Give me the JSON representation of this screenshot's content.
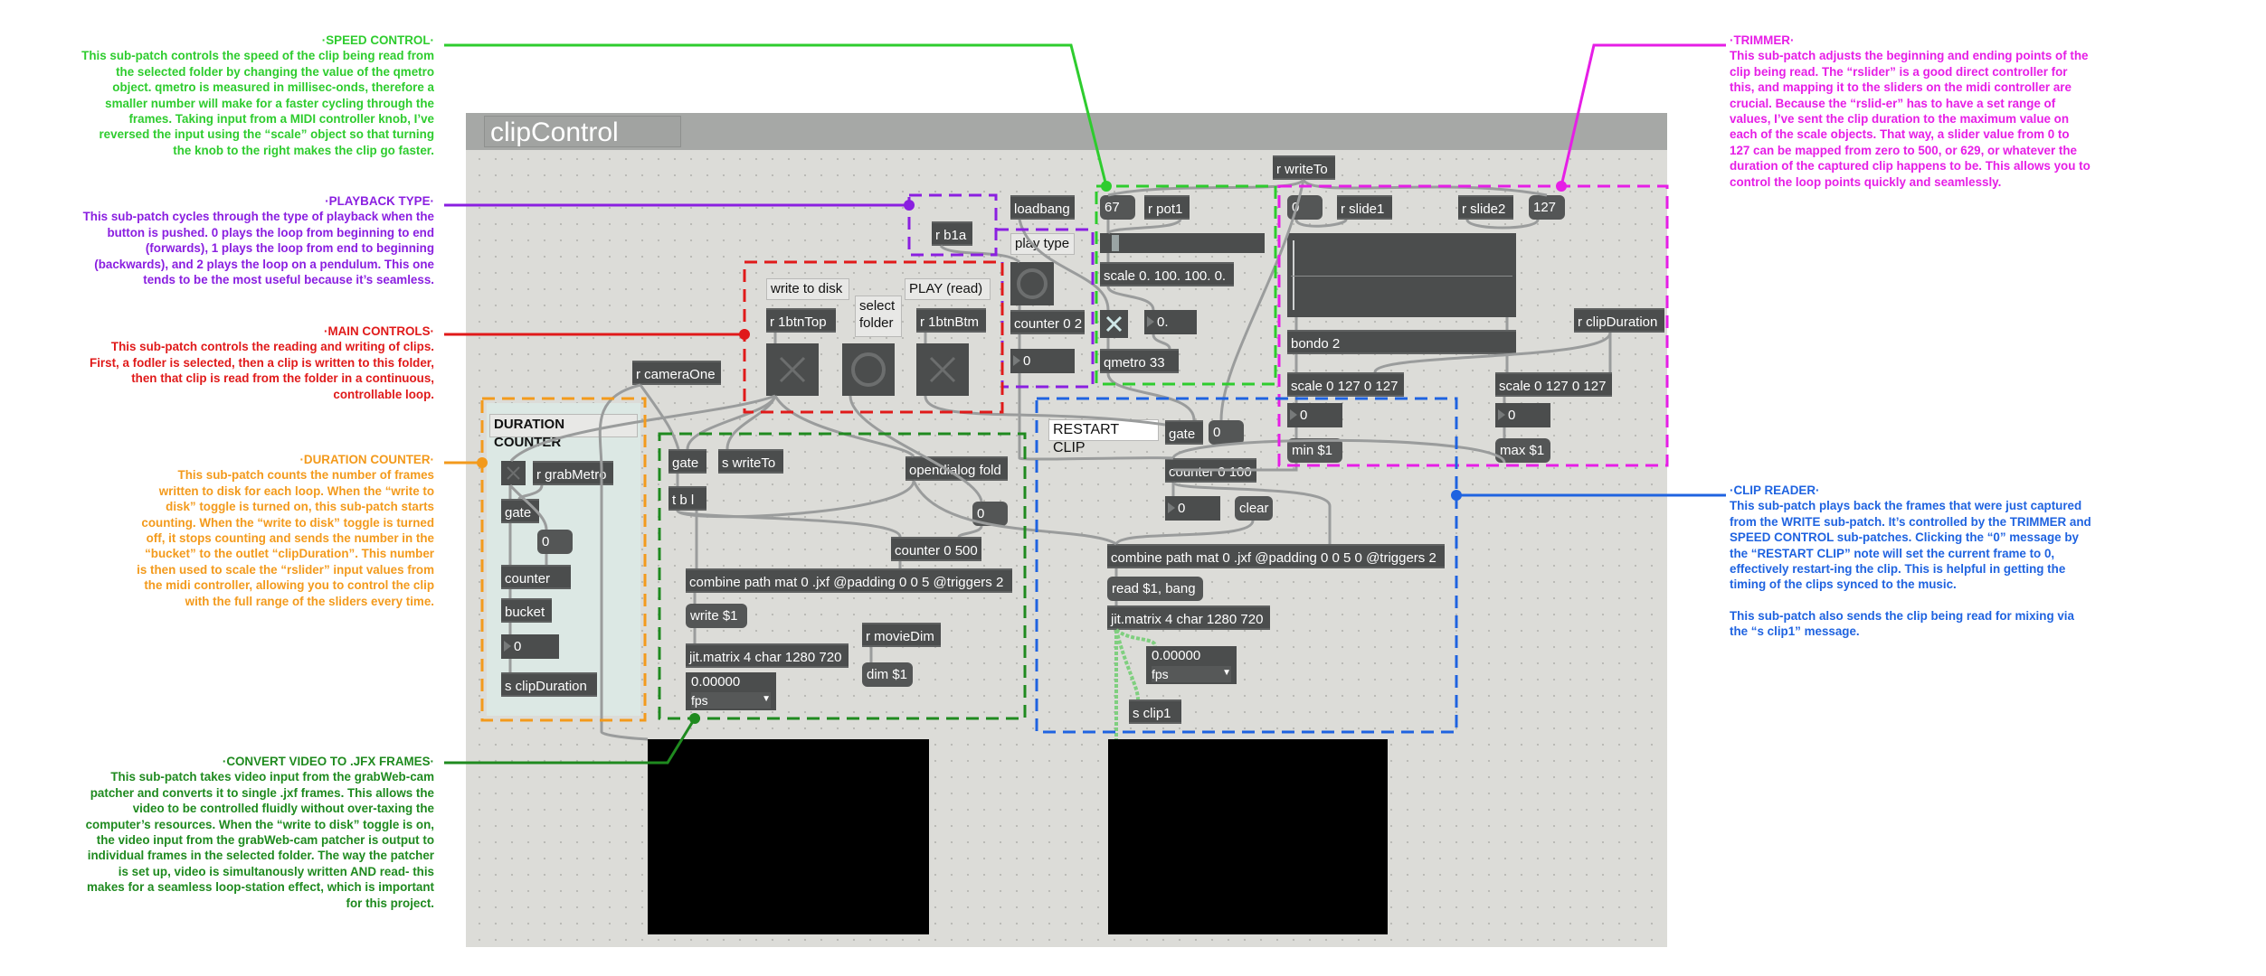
{
  "window": {
    "title": "clipControl"
  },
  "annotations": {
    "speed_control": {
      "heading": "·SPEED CONTROL·",
      "body": "This sub-patch controls the speed of the clip being read from the selected folder by changing the value of the qmetro object. qmetro is measured in millisec-onds, therefore a smaller number will make for a faster cycling through the frames. Taking input from a MIDI controller knob, I’ve reversed the input using the “scale” object so that turning the knob to the right makes the clip go faster.",
      "color": "#2ecc2e"
    },
    "playback_type": {
      "heading": "·PLAYBACK TYPE·",
      "body": "This sub-patch cycles through the type of playback when the button is pushed. 0 plays the loop from beginning to end (forwards), 1 plays the loop from end to beginning (backwards), and 2 plays the loop on a pendulum. This one tends to be the most useful because it’s seamless.",
      "color": "#8a1fe0"
    },
    "main_controls": {
      "heading": "·MAIN CONTROLS·",
      "body": "This sub-patch controls the reading and writing of clips. First, a fodler is selected, then a clip is written to this folder, then that clip is read from the folder in a continuous, controllable loop.",
      "color": "#e01a1a"
    },
    "duration_counter": {
      "heading": "·DURATION COUNTER·",
      "body": "This sub-patch counts the number of frames written to disk for each loop. When the “write to disk” toggle is turned on, this sub-patch starts counting. When the “write to disk” toggle is turned off, it stops counting and sends the number in the “bucket” to the outlet “clipDuration”. This number is then used to scale the “rslider”  input values from the midi controller, allowing you to control the clip with the full range of the sliders every time.",
      "color": "#f39a1c"
    },
    "convert_video": {
      "heading": "·CONVERT VIDEO TO .JFX FRAMES·",
      "body": "This sub-patch takes video input from the grabWeb-cam patcher and converts it to single .jxf frames. This allows the video to be controlled fluidly without over-taxing the computer’s resources. When the “write to disk” toggle is on, the video input from the grabWeb-cam patcher is output to individual frames in the selected folder. The way the patcher is set up, video is simultanously written AND read- this makes for a seamless loop-station effect, which is important for this project.",
      "color": "#1f8a1f"
    },
    "trimmer": {
      "heading": "·TRIMMER·",
      "body": "This sub-patch adjusts the beginning and ending points of the clip being read. The “rslider” is a good direct controller for this, and mapping it to the sliders on the midi controller are crucial. Because the “rslid-er” has to have a set range of values, I’ve sent the clip duration to the maximum value on each of the scale objects. That way, a slider value from 0 to 127 can be mapped from zero to 500, or 629, or whatever the duration of the captured clip happens to be. This allows you to control the loop points quickly and seamlessly.",
      "color": "#e61ee6"
    },
    "clip_reader": {
      "heading": "·CLIP READER·",
      "body": "This sub-patch plays back the frames that were just captured from the WRITE sub-patch. It’s controlled by the TRIMMER and SPEED CONTROL sub-patches. Clicking the “0” message by the “RESTART CLIP” note will set the current frame to 0, effectively restart-ing the clip. This is helpful in getting the timing of the clips synced to the music.",
      "body2": "This sub-patch also sends the clip being read for mixing via the “s clip1” message.",
      "color": "#1f63e0"
    }
  },
  "patcher": {
    "objects": {
      "loadbang": "loadbang",
      "num_speed": "67",
      "r_pot1": "r pot1",
      "r_writeTo": "r writeTo",
      "num_trim_low": "0",
      "r_slide1": "r slide1",
      "r_slide2": "r slide2",
      "num_trim_high": "127",
      "r_b1a": "r b1a",
      "scale_speed": "scale 0. 100. 100. 0.",
      "counter_0_2": "counter 0 2",
      "num_playtype": "0",
      "float_speed": "0.",
      "qmetro": "qmetro 33",
      "bondo": "bondo 2",
      "r_clipDuration": "r clipDuration",
      "r_1btnTop": "r 1btnTop",
      "r_1btnBtm": "r 1btnBtm",
      "r_cameraOne": "r cameraOne",
      "scale_left": "scale 0 127 0 127",
      "scale_right": "scale 0 127 0 127",
      "num_scale_left": "0",
      "num_scale_right": "0",
      "gate_reader": "gate",
      "msg_restart_zero": "0",
      "min": "min $1",
      "max": "max $1",
      "gate_writer": "gate",
      "s_writeTo": "s writeTo",
      "opendialog": "opendialog fold",
      "counter_0_100": "counter 0 100",
      "r_grabMetro": "r grabMetro",
      "tbl": "t b l",
      "gate_dc": "gate",
      "num_reader": "0",
      "clear": "clear",
      "msg_writer_zero": "0",
      "msg_dc_zero": "0",
      "counter_0_500": "counter 0 500",
      "combine_reader": "combine path mat 0 .jxf @padding 0 0 5 0 @triggers 2",
      "counter_dc": "counter",
      "combine_writer": "combine path mat 0 .jxf @padding 0 0 5 @triggers 2",
      "read_msg": "read $1, bang",
      "bucket": "bucket",
      "write_msg": "write $1",
      "jit_matrix_reader": "jit.matrix 4 char 1280 720",
      "r_movieDim": "r movieDim",
      "num_dc": "0",
      "jit_matrix_writer": "jit.matrix 4 char 1280 720",
      "dim_msg": "dim $1",
      "s_clipDuration": "s clipDuration",
      "s_clip1": "s clip1"
    },
    "comments": {
      "play_type": "play type",
      "write_to_disk": "write to disk",
      "select_folder": "select folder",
      "play_read": "PLAY (read)",
      "duration_counter": "DURATION COUNTER",
      "restart_clip": "RESTART CLIP"
    },
    "fpsgui": {
      "writer": {
        "value": "0.00000",
        "unit": "fps"
      },
      "reader": {
        "value": "0.00000",
        "unit": "fps"
      }
    },
    "speed_slider_value": 0.05,
    "speed_toggle_on": true,
    "write_toggle_on": false,
    "play_toggle_on": false,
    "dc_toggle_on": false
  }
}
